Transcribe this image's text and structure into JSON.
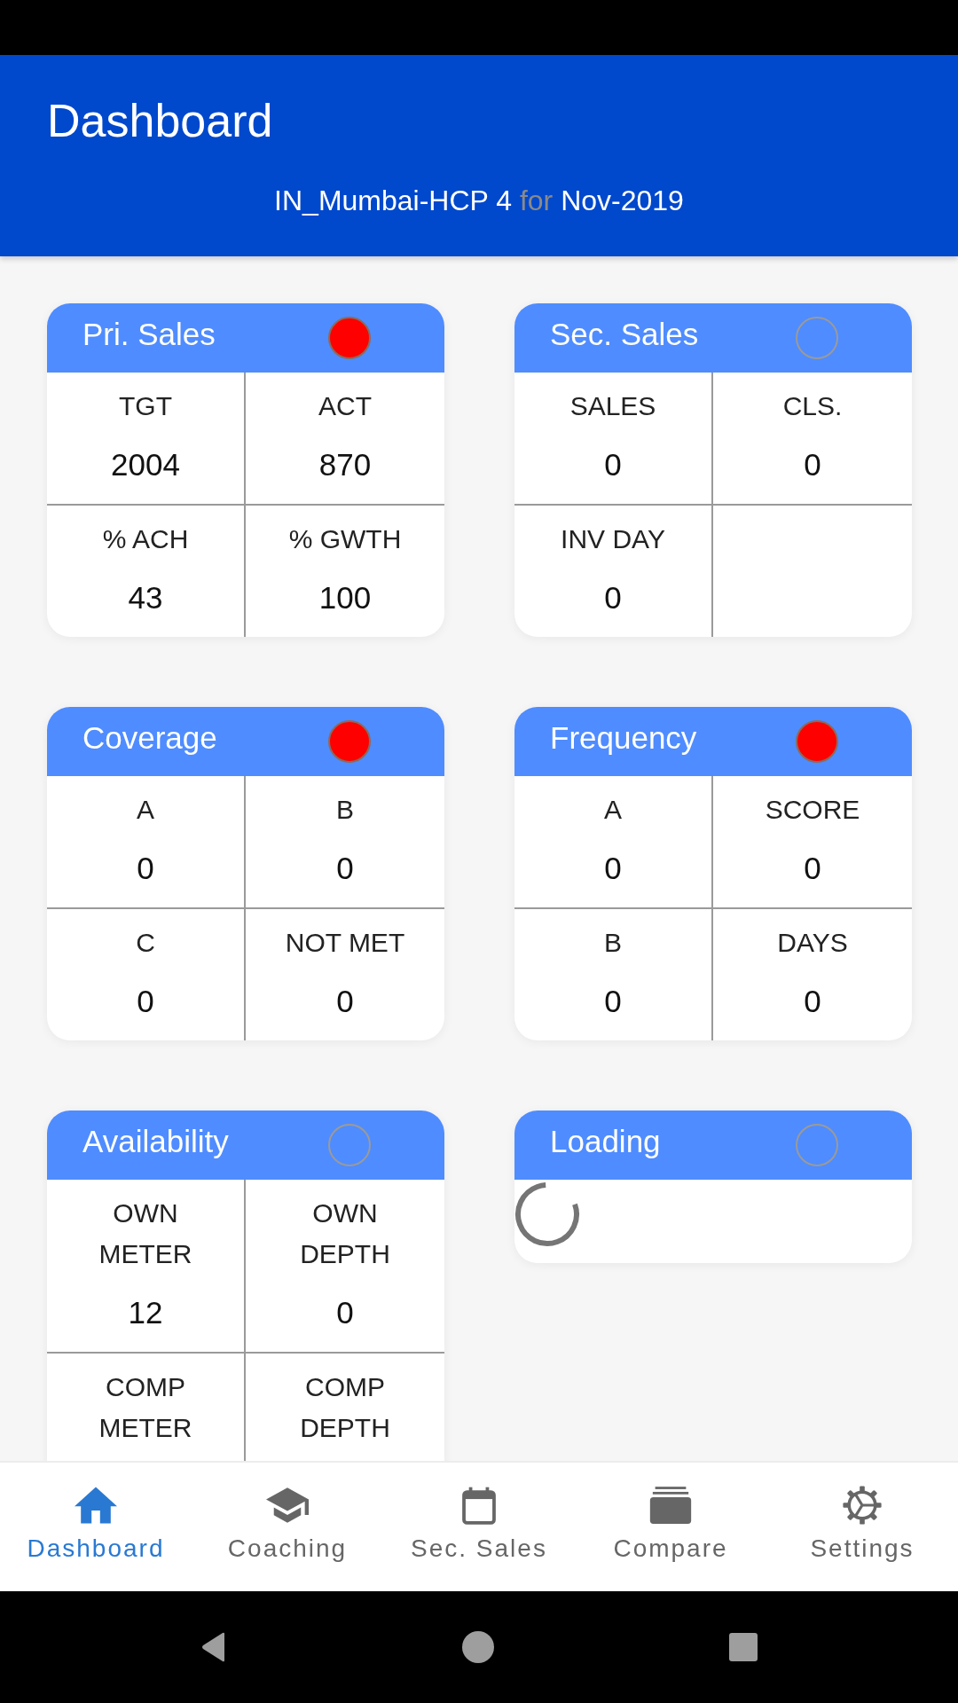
{
  "header": {
    "title": "Dashboard",
    "subtitle": [
      {
        "text": "IN_Mumbai-HCP 4",
        "kind": "value"
      },
      {
        "text": "for",
        "kind": "connector"
      },
      {
        "text": "Nov-2019",
        "kind": "value"
      }
    ]
  },
  "cards": [
    {
      "kind": "metrics",
      "title": "Pri. Sales",
      "indicator_filled": true,
      "color": "#ff0000",
      "cells": [
        {
          "label": "TGT",
          "value": "2004"
        },
        {
          "label": "ACT",
          "value": "870"
        },
        {
          "label": "% ACH",
          "value": "43"
        },
        {
          "label": "% GWTH",
          "value": "100"
        }
      ]
    },
    {
      "kind": "metrics",
      "title": "Sec. Sales",
      "indicator_filled": false,
      "cells": [
        {
          "label": "SALES",
          "value": "0"
        },
        {
          "label": "CLS.",
          "value": "0"
        },
        {
          "label": "INV DAY",
          "value": "0"
        }
      ]
    },
    {
      "kind": "metrics",
      "title": "Coverage",
      "indicator_filled": true,
      "color": "#ff0000",
      "cells": [
        {
          "label": "A",
          "value": "0"
        },
        {
          "label": "B",
          "value": "0"
        },
        {
          "label": "C",
          "value": "0"
        },
        {
          "label": "NOT MET",
          "value": "0"
        }
      ]
    },
    {
      "kind": "metrics",
      "title": "Frequency",
      "indicator_filled": true,
      "color": "#ff0000",
      "cells": [
        {
          "label": "A",
          "value": "0"
        },
        {
          "label": "SCORE",
          "value": "0"
        },
        {
          "label": "B",
          "value": "0"
        },
        {
          "label": "DAYS",
          "value": "0"
        }
      ]
    },
    {
      "kind": "metrics",
      "title": "Availability",
      "indicator_filled": false,
      "cells": [
        {
          "label": "OWN\nMETER",
          "value": "12"
        },
        {
          "label": "OWN\nDEPTH",
          "value": "0"
        },
        {
          "label": "COMP\nMETER"
        },
        {
          "label": "COMP\nDEPTH"
        }
      ]
    },
    {
      "kind": "loading",
      "title": "Loading",
      "indicator_filled": false
    }
  ],
  "bottom_nav": [
    {
      "label": "Dashboard",
      "selected": true
    },
    {
      "label": "Coaching",
      "selected": false
    },
    {
      "label": "Sec. Sales",
      "selected": false
    },
    {
      "label": "Compare",
      "selected": false
    },
    {
      "label": "Settings",
      "selected": false
    }
  ]
}
